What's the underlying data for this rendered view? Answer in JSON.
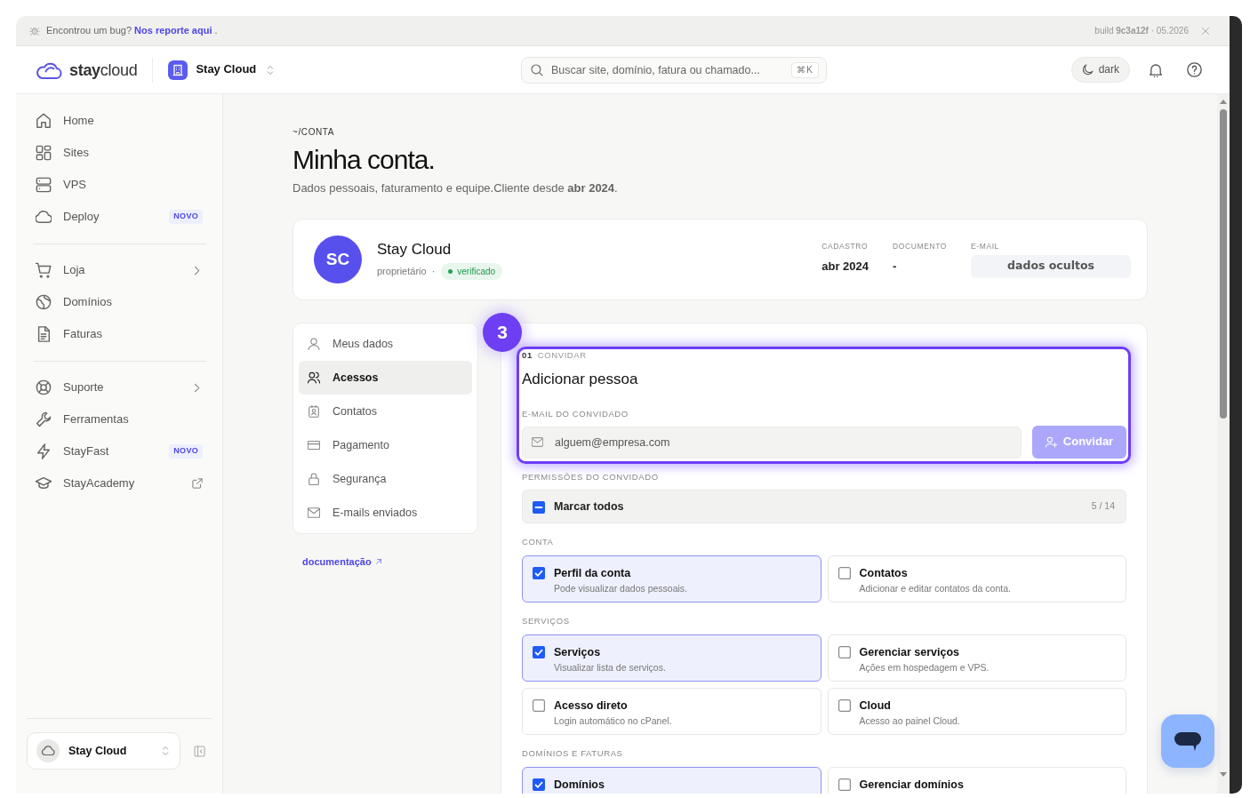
{
  "bug_bar": {
    "message": "Encontrou um bug?",
    "link": "Nos reporte aqui",
    "end": ".",
    "build": "build **9c3a12f** · 05.2026"
  },
  "header": {
    "logo": "**stay**cloud",
    "workspace": "Stay Cloud",
    "search": {
      "placeholder": "Buscar site, domínio, fatura ou chamado...",
      "shortcut": "⌘K"
    },
    "theme_button": "dark"
  },
  "sidebar": {
    "groups": [
      {
        "items": [
          {
            "label": "Home",
            "kind": "link",
            "selected": false
          },
          {
            "label": "Sites",
            "kind": "link",
            "selected": false
          },
          {
            "label": "VPS",
            "kind": "link",
            "selected": false
          },
          {
            "label": "Deploy",
            "kind": "link",
            "badge": "NOVO",
            "selected": false
          }
        ]
      },
      {
        "items": [
          {
            "label": "Loja",
            "kind": "submenu",
            "selected": false
          },
          {
            "label": "Domínios",
            "kind": "link",
            "selected": false
          },
          {
            "label": "Faturas",
            "kind": "link",
            "selected": false
          }
        ]
      },
      {
        "items": [
          {
            "label": "Suporte",
            "kind": "submenu",
            "selected": false
          },
          {
            "label": "Ferramentas",
            "kind": "link",
            "selected": false
          },
          {
            "label": "StayFast",
            "kind": "link",
            "badge": "NOVO",
            "selected": false
          },
          {
            "label": "StayAcademy",
            "kind": "external",
            "selected": false
          }
        ]
      }
    ],
    "account": "Stay Cloud"
  },
  "page": {
    "breadcrumb": "~/CONTA",
    "title": "Minha conta.",
    "subtitle": "Dados pessoais, faturamento e equipe.Cliente desde **abr 2024**."
  },
  "profile": {
    "initials": "SC",
    "name": "Stay Cloud",
    "role": "proprietário",
    "separator": "·",
    "badge": "verificado",
    "facts": [
      {
        "label": "CADASTRO",
        "value": "abr 2024",
        "kind": "text"
      },
      {
        "label": "DOCUMENTO",
        "value": "-",
        "kind": "text"
      },
      {
        "label": "E-MAIL",
        "value": "dados ocultos",
        "kind": "masked"
      }
    ]
  },
  "account_nav": {
    "items": [
      {
        "label": "Meus dados",
        "selected": false
      },
      {
        "label": "Acessos",
        "selected": true
      },
      {
        "label": "Contatos",
        "selected": false
      },
      {
        "label": "Pagamento",
        "selected": false
      },
      {
        "label": "Segurança",
        "selected": false
      },
      {
        "label": "E-mails enviados",
        "selected": false
      }
    ],
    "doc_link": "documentação"
  },
  "invite": {
    "step": "01",
    "section": "CONVIDAR",
    "title": "Adicionar pessoa",
    "email_label": "E-MAIL DO CONVIDADO",
    "email": {
      "placeholder": "alguem@empresa.com"
    },
    "button": {
      "label": "Convidar",
      "disabled": true
    }
  },
  "permissions": {
    "label": "PERMISSÕES DO CONVIDADO",
    "select_all": {
      "label": "Marcar todos",
      "indeterminate": true,
      "count": "5 / 14"
    },
    "groups": [
      {
        "title": "CONTA",
        "items": [
          {
            "title": "Perfil da conta",
            "description": "Pode visualizar dados pessoais.",
            "checked": true
          },
          {
            "title": "Contatos",
            "description": "Adicionar e editar contatos da conta.",
            "checked": false
          }
        ]
      },
      {
        "title": "SERVIÇOS",
        "items": [
          {
            "title": "Serviços",
            "description": "Visualizar lista de serviços.",
            "checked": true
          },
          {
            "title": "Gerenciar serviços",
            "description": "Ações em hospedagem e VPS.",
            "checked": false
          },
          {
            "title": "Acesso direto",
            "description": "Login automático no cPanel.",
            "checked": false
          },
          {
            "title": "Cloud",
            "description": "Acesso ao painel Cloud.",
            "checked": false
          }
        ]
      },
      {
        "title": "DOMÍNIOS E FATURAS",
        "items": [
          {
            "title": "Domínios",
            "checked": true
          },
          {
            "title": "Gerenciar domínios",
            "checked": false
          }
        ]
      }
    ]
  },
  "tour": {
    "step": "3"
  }
}
